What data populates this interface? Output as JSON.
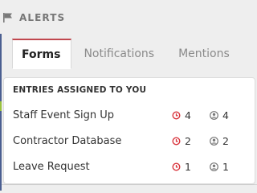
{
  "header": {
    "title": "ALERTS",
    "icon": "flag-icon"
  },
  "tabs": [
    {
      "label": "Forms",
      "active": true
    },
    {
      "label": "Notifications",
      "active": false
    },
    {
      "label": "Mentions",
      "active": false
    }
  ],
  "panel": {
    "title": "ENTRIES ASSIGNED TO YOU",
    "rows": [
      {
        "label": "Staff Event Sign Up",
        "overdue": "4",
        "assigned": "4"
      },
      {
        "label": "Contractor Database",
        "overdue": "2",
        "assigned": "2"
      },
      {
        "label": "Leave Request",
        "overdue": "1",
        "assigned": "1"
      }
    ]
  },
  "colors": {
    "accent": "#c0474e",
    "overdue_icon": "#d9363e",
    "user_icon": "#777777"
  }
}
